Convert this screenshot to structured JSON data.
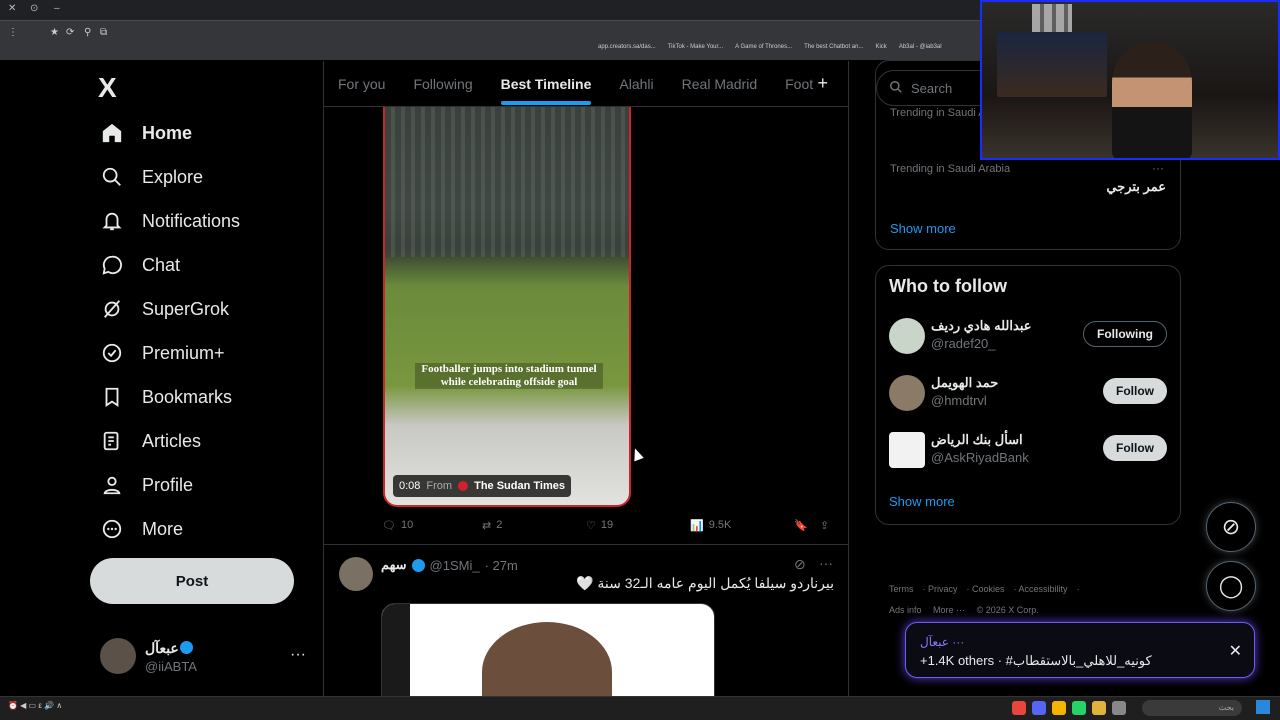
{
  "browser": {
    "bookmarks": [
      "app.creators.sa/das...",
      "TikTok - Make Your...",
      "A Game of Thrones...",
      "The best Chatbot an...",
      "Kick",
      "Ab3al - @iab3al"
    ]
  },
  "sidebar": {
    "logo": "X",
    "items": [
      {
        "label": "Home",
        "icon": "home-icon"
      },
      {
        "label": "Explore",
        "icon": "search-icon"
      },
      {
        "label": "Notifications",
        "icon": "bell-icon"
      },
      {
        "label": "Chat",
        "icon": "chat-bubble-icon"
      },
      {
        "label": "SuperGrok",
        "icon": "grok-icon"
      },
      {
        "label": "Premium+",
        "icon": "verified-badge-icon"
      },
      {
        "label": "Bookmarks",
        "icon": "bookmark-icon"
      },
      {
        "label": "Articles",
        "icon": "article-icon"
      },
      {
        "label": "Profile",
        "icon": "person-icon"
      },
      {
        "label": "More",
        "icon": "more-circle-icon"
      }
    ],
    "post_label": "Post",
    "account": {
      "name": "عبعآل",
      "handle": "@iiABTA"
    }
  },
  "timeline": {
    "tabs": [
      "For you",
      "Following",
      "Best Timeline",
      "Alahli",
      "Real Madrid",
      "Foot"
    ],
    "active_tab": "Best Timeline",
    "video": {
      "caption": "Footballer jumps into stadium tunnel while celebrating offside goal",
      "duration": "0:08",
      "from_label": "From",
      "source": "The Sudan Times"
    },
    "actions": {
      "replies": "10",
      "reposts": "2",
      "likes": "19",
      "views": "9.5K"
    },
    "post2": {
      "name": "سهم",
      "handle": "@1SMi_",
      "time": "· 27m",
      "text": "بيرناردو سيلفا يُكمل اليوم عامه الـ32 سنة 🤍"
    }
  },
  "right": {
    "search_placeholder": "Search",
    "trends": [
      {
        "context": "Trending in Saudi Arabia",
        "name": ""
      },
      {
        "context": "Trending in Saudi Arabia",
        "name": "عمر بترجي"
      }
    ],
    "show_more": "Show more",
    "who_to_follow": {
      "title": "Who to follow",
      "people": [
        {
          "name": "عبدالله هادي رديف",
          "handle": "@radef20_",
          "button": "Following"
        },
        {
          "name": "حمد الهويمل",
          "handle": "@hmdtrvl",
          "button": "Follow"
        },
        {
          "name": "اسأل بنك الرياض",
          "handle": "@AskRiyadBank",
          "button": "Follow"
        }
      ],
      "show_more": "Show more"
    },
    "footer": [
      "Terms",
      "Privacy",
      "Cookies",
      "Accessibility",
      "Ads info",
      "More ···",
      "© 2026 X Corp."
    ]
  },
  "toast": {
    "line1": "عبعآل ···",
    "line2": "+1.4K others · #كونيه_للاهلي_بالاستقطاب"
  },
  "taskbar": {
    "search": "بحث"
  }
}
